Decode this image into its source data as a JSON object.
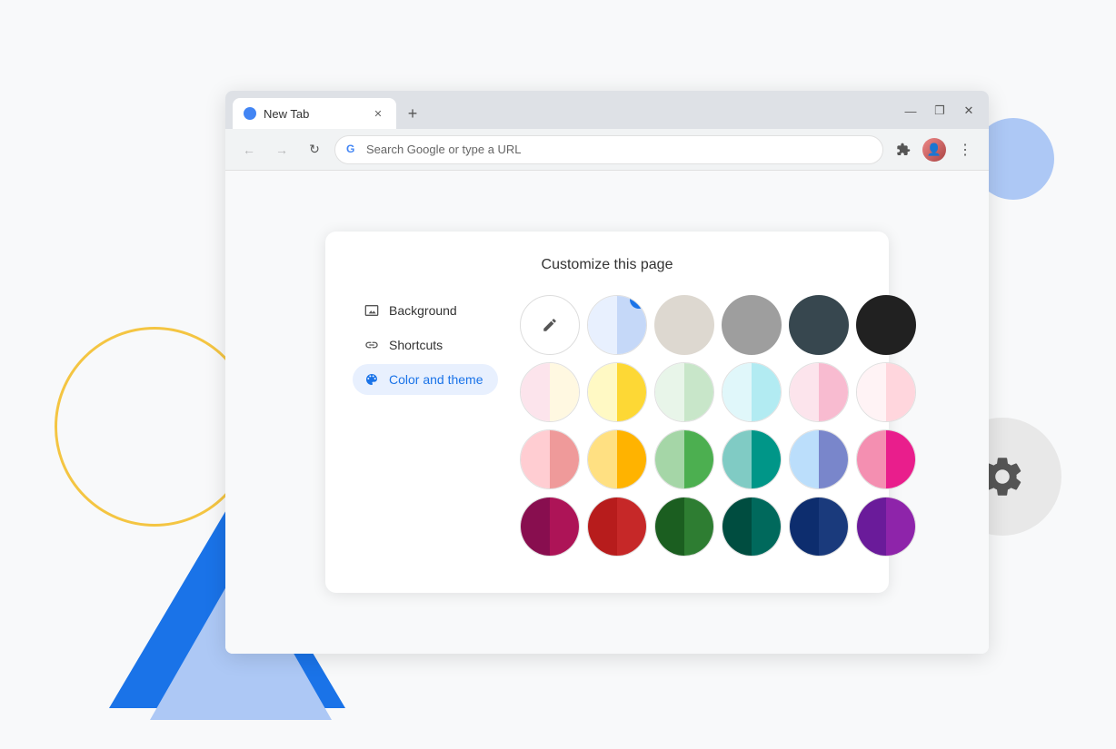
{
  "decorative": {
    "gear_label": "Settings gear"
  },
  "browser": {
    "tab_title": "New Tab",
    "url_placeholder": "Search Google or type a URL",
    "window_controls": {
      "minimize": "—",
      "maximize": "❐",
      "close": "✕"
    }
  },
  "page": {
    "title": "Customize this page",
    "nav": [
      {
        "id": "background",
        "label": "Background",
        "icon": "🖼"
      },
      {
        "id": "shortcuts",
        "label": "Shortcuts",
        "icon": "🔗"
      },
      {
        "id": "color-and-theme",
        "label": "Color and theme",
        "icon": "🎨",
        "active": true
      }
    ],
    "toolbar": {
      "custom_label": "Custom color",
      "custom_icon": "✏️"
    },
    "colors": {
      "row1": [
        {
          "id": "custom",
          "type": "custom"
        },
        {
          "id": "white-blue",
          "type": "half",
          "left": "#f0f4ff",
          "right": "#cce0ff",
          "selected": true
        },
        {
          "id": "light-gray",
          "type": "solid",
          "color": "#e0d8d0"
        },
        {
          "id": "medium-gray",
          "type": "solid",
          "color": "#9e9e9e"
        },
        {
          "id": "dark-slate",
          "type": "solid",
          "color": "#37474f"
        },
        {
          "id": "black",
          "type": "solid",
          "color": "#212121"
        }
      ],
      "row2": [
        {
          "id": "peach-light",
          "type": "half",
          "left": "#fce4ec",
          "right": "#fff8e1"
        },
        {
          "id": "yellow",
          "type": "half",
          "left": "#fff59d",
          "right": "#ffcc02"
        },
        {
          "id": "mint-light",
          "type": "half",
          "left": "#e8f5e9",
          "right": "#c8e6c9"
        },
        {
          "id": "cyan-light",
          "type": "half",
          "left": "#e0f7fa",
          "right": "#b2ebf2"
        },
        {
          "id": "lavender-light",
          "type": "half",
          "left": "#fce4ec",
          "right": "#f8bbd0"
        },
        {
          "id": "pink-light",
          "type": "half",
          "left": "#fff3f5",
          "right": "#ffd6dd"
        }
      ],
      "row3": [
        {
          "id": "peach",
          "type": "half",
          "left": "#ffcdd2",
          "right": "#ff8a65"
        },
        {
          "id": "orange",
          "type": "half",
          "left": "#ffcc80",
          "right": "#ff9800"
        },
        {
          "id": "green",
          "type": "half",
          "left": "#a5d6a7",
          "right": "#4caf50"
        },
        {
          "id": "teal",
          "type": "half",
          "left": "#80cbc4",
          "right": "#009688"
        },
        {
          "id": "periwinkle",
          "type": "half",
          "left": "#bbdefb",
          "right": "#7986cb"
        },
        {
          "id": "hot-pink",
          "type": "half",
          "left": "#f48fb1",
          "right": "#e91e8c"
        }
      ],
      "row4": [
        {
          "id": "burgundy",
          "type": "half",
          "left": "#880e4f",
          "right": "#ad1457"
        },
        {
          "id": "crimson",
          "type": "half",
          "left": "#b71c1c",
          "right": "#c62828"
        },
        {
          "id": "forest-green",
          "type": "half",
          "left": "#1b5e20",
          "right": "#2e7d32"
        },
        {
          "id": "dark-teal",
          "type": "half",
          "left": "#004d40",
          "right": "#00695c"
        },
        {
          "id": "navy",
          "type": "half",
          "left": "#0d2d6e",
          "right": "#1a3a7c"
        },
        {
          "id": "purple",
          "type": "half",
          "left": "#6a1b9a",
          "right": "#7b1fa2"
        }
      ]
    }
  }
}
